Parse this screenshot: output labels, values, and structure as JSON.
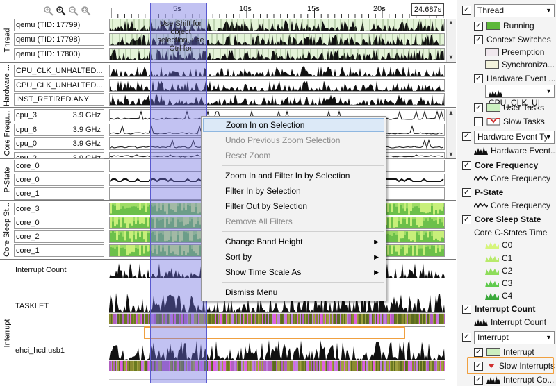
{
  "toolbar": {
    "icons": [
      "zoom-in-icon",
      "zoom-out-icon",
      "zoom-reset-icon",
      "zoom-fit-icon"
    ]
  },
  "ruler": {
    "ticks": [
      "5s",
      "10s",
      "15s",
      "20s"
    ],
    "time_readout": "24.687s"
  },
  "selection_tooltip": "Use Shift for object selection, use Ctrl for",
  "groups": [
    "Thread",
    "Hardware ...",
    "Core Frequ...",
    "P-State",
    "Core Sleep St...",
    "Interrupt"
  ],
  "rows": {
    "thread": [
      "qemu (TID: 17799)",
      "qemu (TID: 17798)",
      "qemu (TID: 17800)"
    ],
    "hardware": [
      "CPU_CLK_UNHALTED...",
      "CPU_CLK_UNHALTED...",
      "INST_RETIRED.ANY"
    ],
    "core_freq": [
      {
        "name": "cpu_3",
        "freq": "3.9 GHz"
      },
      {
        "name": "cpu_6",
        "freq": "3.9 GHz"
      },
      {
        "name": "cpu_0",
        "freq": "3.9 GHz"
      },
      {
        "name": "cpu_2",
        "freq": "3.9 GHz"
      }
    ],
    "pstate": [
      "core_0",
      "core_0",
      "core_1"
    ],
    "sleep": [
      "core_3",
      "core_0",
      "core_2",
      "core_1"
    ],
    "interrupt_count": "Interrupt Count",
    "interrupt": [
      "TASKLET",
      "ehci_hcd:usb1"
    ]
  },
  "context_menu": {
    "items": [
      {
        "label": "Zoom In on Selection",
        "state": "highlighted"
      },
      {
        "label": "Undo Previous Zoom Selection",
        "state": "disabled"
      },
      {
        "label": "Reset Zoom",
        "state": "disabled"
      },
      {
        "label": "Zoom In and Filter In by Selection",
        "state": "enabled"
      },
      {
        "label": "Filter In by Selection",
        "state": "enabled"
      },
      {
        "label": "Filter Out by Selection",
        "state": "enabled"
      },
      {
        "label": "Remove All Filters",
        "state": "disabled"
      },
      {
        "label": "Change Band Height",
        "state": "submenu"
      },
      {
        "label": "Sort by",
        "state": "submenu"
      },
      {
        "label": "Show Time Scale As",
        "state": "submenu"
      },
      {
        "label": "Dismiss Menu",
        "state": "enabled"
      }
    ]
  },
  "legend": {
    "thread_dropdown": "Thread",
    "running": "Running",
    "context_switches": "Context Switches",
    "preemption": "Preemption",
    "synchronization": "Synchroniza...",
    "hardware_event": "Hardware Event ...",
    "hw_event_dropdown": "CPU_CLK_UI",
    "user_tasks": "User Tasks",
    "slow_tasks": "Slow Tasks",
    "hardware_event_type_dropdown": "Hardware Event Ty",
    "hardware_event_sample": "Hardware Event...",
    "core_frequency": "Core Frequency",
    "core_frequency_sample": "Core Frequency",
    "pstate": "P-State",
    "pstate_sample": "Core Frequency",
    "core_sleep_state": "Core Sleep State",
    "c_states_title": "Core C-States Time",
    "c_states": [
      "C0",
      "C1",
      "C2",
      "C3",
      "C4"
    ],
    "interrupt_count": "Interrupt Count",
    "interrupt_count_sample": "Interrupt Count",
    "interrupt_dropdown": "Interrupt",
    "interrupt": "Interrupt",
    "slow_interrupts": "Slow Interrupts",
    "interrupt_count_bottom": "Interrupt Co..."
  },
  "colors": {
    "selection": "#6e6ee1",
    "thread_fill": "#e4f4d8",
    "sleep_green": "#5db83a",
    "highlight_box": "#f0a040",
    "slow_task_red": "#d03030"
  }
}
